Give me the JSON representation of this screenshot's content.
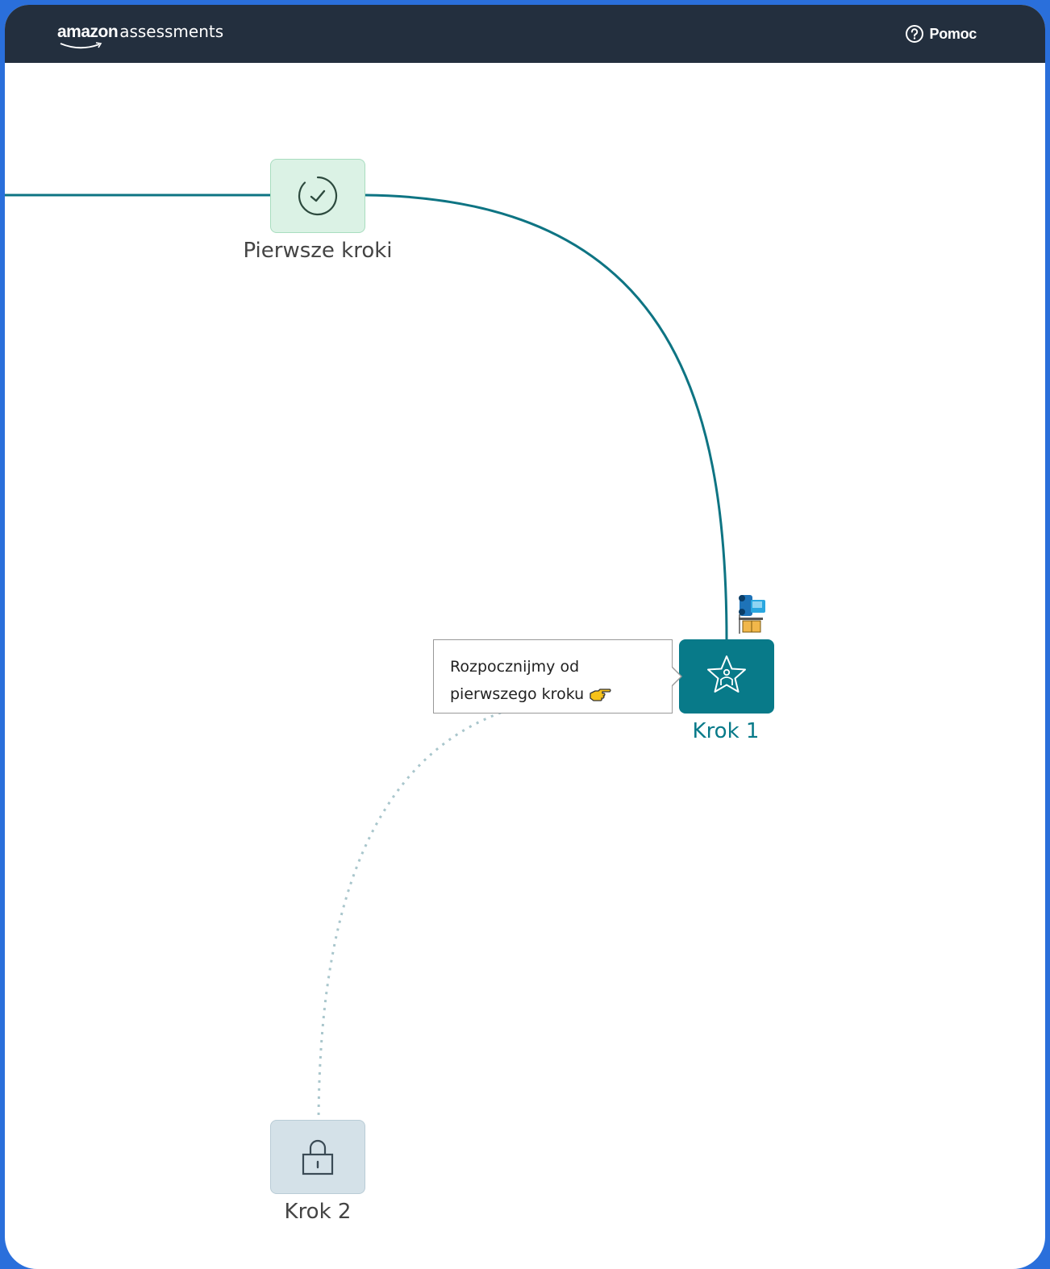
{
  "header": {
    "brand_amazon": "amazon",
    "brand_assessments": "assessments",
    "help_label": "Pomoc",
    "help_icon": "question-circle-icon"
  },
  "path": {
    "nodes": [
      {
        "label": "Pierwsze kroki",
        "state": "completed",
        "icon": "check-circle-icon"
      },
      {
        "label": "Krok 1",
        "state": "current",
        "icon": "star-person-icon"
      },
      {
        "label": "Krok 2",
        "state": "locked",
        "icon": "lock-icon"
      }
    ],
    "tooltip": {
      "line1": "Rozpocznijmy od",
      "line2": "pierwszego kroku",
      "icon": "pointing-hand-icon"
    },
    "avatar_icon": "truck-icon"
  },
  "colors": {
    "header_bg": "#232f3e",
    "frame_bg": "#2a6fdb",
    "path_active": "#0e7483",
    "path_locked": "#a9c6cc",
    "node_current": "#087a89",
    "node_completed": "#dbf2e5",
    "node_locked": "#d4e1e8"
  }
}
